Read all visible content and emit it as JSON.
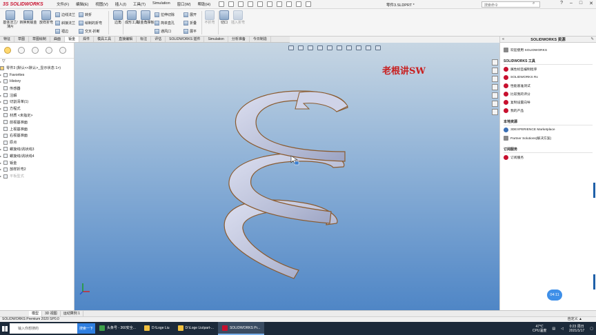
{
  "app": {
    "logo_text": "3S SOLIDWORKS",
    "menus": [
      "文件(F)",
      "编辑(E)",
      "视图(V)",
      "插入(I)",
      "工具(T)",
      "Simulation",
      "窗口(W)",
      "帮助(H)"
    ],
    "doc_title": "零件3.SLDPRT *",
    "search_placeholder": "搜索命令",
    "win_controls": [
      "?",
      "–",
      "□",
      "✕"
    ]
  },
  "ribbon": {
    "big_buttons": [
      "基体法兰/薄片",
      "转换到钣金",
      "放样折弯",
      "边角",
      "插入折弯",
      "钣金角撑板",
      "切口"
    ],
    "small_buttons": [
      "边线法兰",
      "斜接法兰",
      "褶边",
      "转折",
      "绘制的折弯",
      "交叉-折断",
      "拉伸切除",
      "简单直孔",
      "通风口",
      "展开",
      "折叠",
      "展平",
      "成形工具",
      "不折弯"
    ]
  },
  "tabs": [
    "特征",
    "草图",
    "草图绘制",
    "曲面",
    "钣金",
    "焊件",
    "模具工具",
    "直接编辑",
    "标注",
    "评估",
    "SOLIDWORKS 插件",
    "Simulation",
    "分析准备",
    "今日制造"
  ],
  "active_tab": "钣金",
  "tree": {
    "root": "零件3 (默认<<默认>_显示状态 1>)",
    "items": [
      "Favorites",
      "History",
      "传感器",
      "注解",
      "切割清单(1)",
      "方程式",
      "材质 <未指定>",
      "前视基准面",
      "上视基准面",
      "右视基准面",
      "原点",
      "螺旋线/涡状线3",
      "螺旋线/涡状线4",
      "钣金",
      "放样折弯2",
      "平板型式"
    ]
  },
  "viewport": {
    "watermark": "老根讲SW"
  },
  "task_pane": {
    "title": "SOLIDWORKS 资源",
    "top_item": "欢迎使用 SOLIDWORKS",
    "section1_title": "SOLIDWORKS 工具",
    "section1_items": [
      "属性标签编制程序",
      "SOLIDWORKS Rx",
      "性能基准测试",
      "比较我的评分",
      "复制设置向导",
      "我的产品"
    ],
    "section2_title": "本地资源",
    "section2_items": [
      "3DEXPERIENCE Marketplace",
      "Partner Solutions(解决方案)"
    ],
    "section3_title": "订阅服务",
    "section3_items": [
      "订阅服务"
    ],
    "timer": "04:11"
  },
  "model_tabs": [
    "模型",
    "3D 视图",
    "运动算例 1"
  ],
  "status": {
    "left": "SOLIDWORKS Premium 2020 SP0.0",
    "right": "自定义 ▲"
  },
  "taskbar": {
    "search_placeholder": "输入你想搜的",
    "search_button": "搜索一下",
    "apps": [
      "头条号 - 360安全...",
      "D:\\Loge Liu",
      "D:\\Loge Liu\\part-...",
      "SOLIDWORKS Pr..."
    ],
    "temp": "47℃",
    "temp_label": "CPU温度",
    "time": "0:23 周日",
    "date": "2021/1/17"
  }
}
